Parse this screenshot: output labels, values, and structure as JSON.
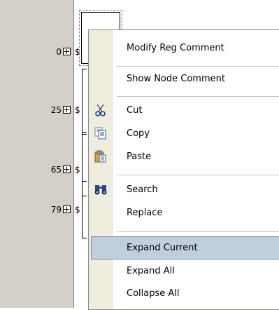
{
  "gutter": {
    "rows": [
      {
        "number": "0"
      },
      {
        "number": "25"
      },
      {
        "number": "65"
      },
      {
        "number": "79"
      }
    ],
    "dollar": "$"
  },
  "context_menu": {
    "items": [
      {
        "label": "Modify Reg Comment",
        "icon": null
      },
      {
        "label": "Show Node Comment",
        "icon": null
      },
      {
        "label": "Cut",
        "icon": "scissors-icon"
      },
      {
        "label": "Copy",
        "icon": "copy-icon"
      },
      {
        "label": "Paste",
        "icon": "paste-icon"
      },
      {
        "label": "Search",
        "icon": "binoculars-icon"
      },
      {
        "label": "Replace",
        "icon": null
      },
      {
        "label": "Expand Current",
        "icon": null,
        "highlighted": true
      },
      {
        "label": "Expand All",
        "icon": null
      },
      {
        "label": "Collapse All",
        "icon": null
      }
    ]
  },
  "colors": {
    "gutter": "#d4d0c8",
    "menu_iconbar": "#efedde",
    "highlight": "#c1cede",
    "highlight_border": "#6e8bae"
  }
}
